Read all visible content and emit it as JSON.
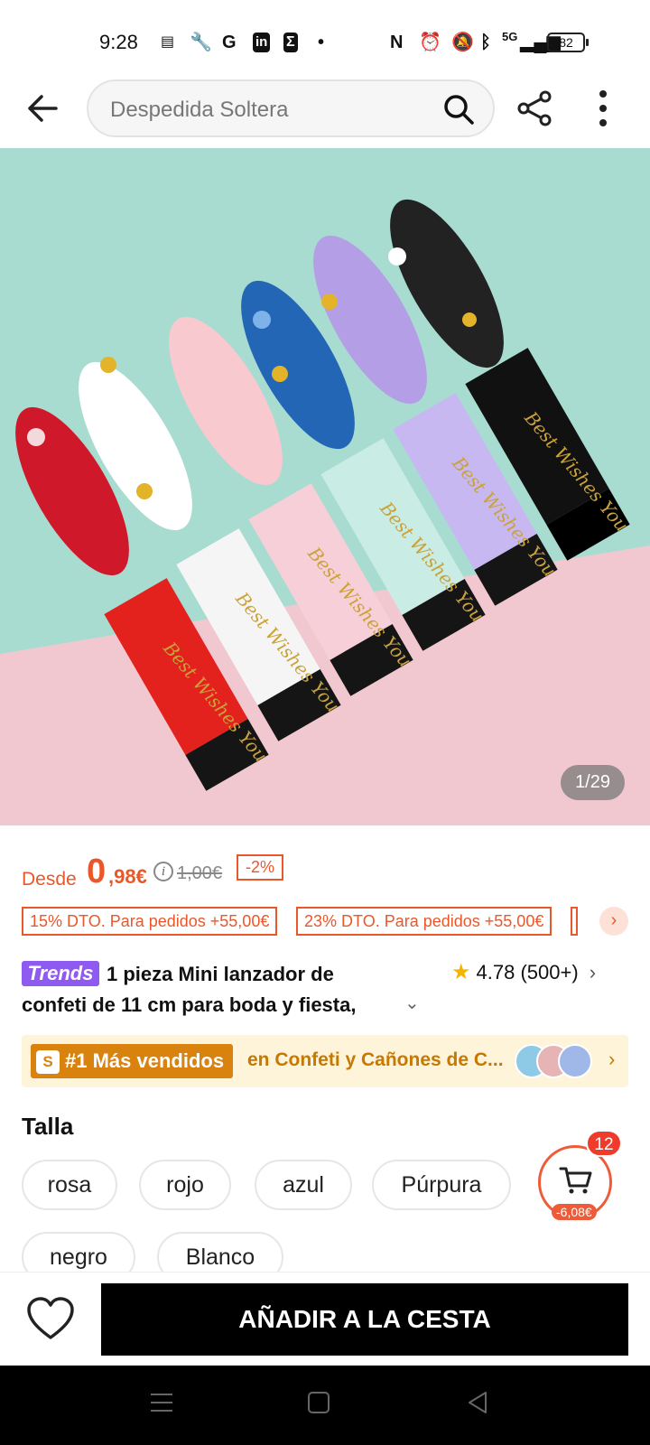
{
  "status_bar": {
    "time": "9:28",
    "network": "5G",
    "battery": "82"
  },
  "header": {
    "search_placeholder": "Despedida Soltera",
    "icons": [
      "back-arrow-icon",
      "search-icon",
      "share-icon",
      "more-vertical-icon"
    ]
  },
  "gallery": {
    "counter": "1/29",
    "tube_text": "Best Wishes You"
  },
  "price": {
    "prefix": "Desde",
    "integer": "0",
    "decimal": ",98€",
    "original": "1,00€",
    "discount": "-2%"
  },
  "coupons": [
    "15% DTO. Para pedidos +55,00€",
    "23% DTO. Para pedidos +55,00€"
  ],
  "product": {
    "trend_badge": "Trends",
    "title": "1 pieza Mini lanzador de confeti de 11 cm para boda y fiesta,",
    "rating": "4.78",
    "reviews": "(500+)"
  },
  "bestseller": {
    "badge": "#1 Más vendidos",
    "category": "en Confeti y Cañones de C..."
  },
  "size": {
    "label": "Talla",
    "options": [
      "rosa",
      "rojo",
      "azul",
      "Púrpura",
      "negro",
      "Blanco"
    ]
  },
  "cart": {
    "count": "12",
    "saving": "-6,08€"
  },
  "actions": {
    "add_to_cart": "AÑADIR A LA CESTA"
  },
  "colors": {
    "accent": "#e8582b",
    "trends": "#8e5af0",
    "bestseller": "#d9820e"
  }
}
